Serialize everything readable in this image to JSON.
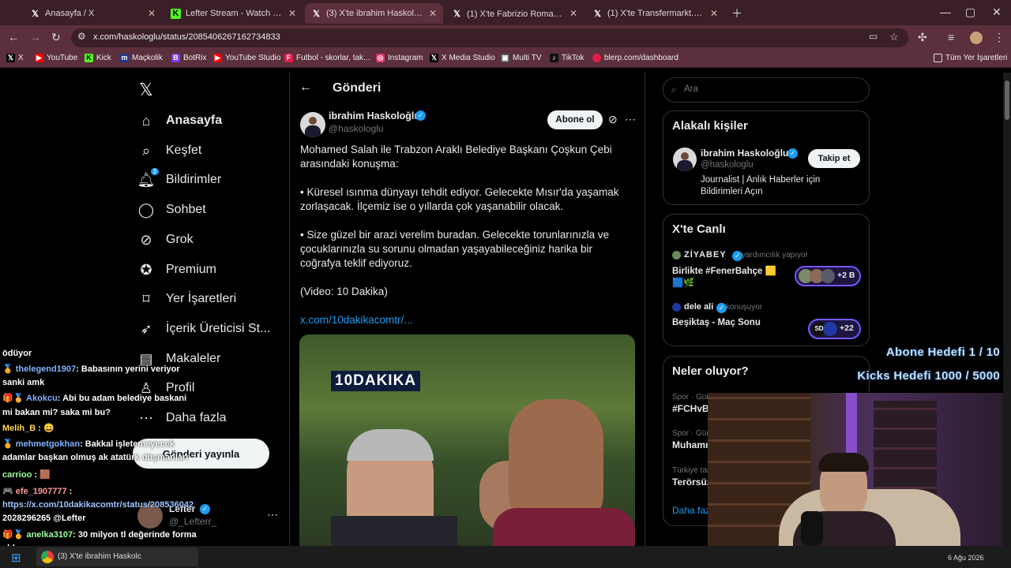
{
  "browser": {
    "tabs": [
      {
        "title": "Anasayfa / X",
        "icon": "x-icon",
        "color": "#ffffff"
      },
      {
        "title": "Lefter Stream - Watch Live on Kick",
        "icon": "kick-icon",
        "color": "#53fc18"
      },
      {
        "title": "(3) X'te ibrahim Haskoloğlu: \"M",
        "icon": "x-icon",
        "color": "#ffffff"
      },
      {
        "title": "(1) X'te Fabrizio Romano: \"🚨",
        "icon": "x-icon",
        "color": "#ffffff"
      },
      {
        "title": "(1) X'te Transfermarkt.com.tr: \"",
        "icon": "x-icon",
        "color": "#ffffff"
      }
    ],
    "url": "x.com/haskologlu/status/2085406267162734833",
    "bookmarks": [
      {
        "label": "X",
        "color": "#000000"
      },
      {
        "label": "YouTube",
        "color": "#ff0000"
      },
      {
        "label": "Kick",
        "color": "#53fc18"
      },
      {
        "label": "Maçkolik",
        "color": "#1e3a8a"
      },
      {
        "label": "BotRix",
        "color": "#7c3aed"
      },
      {
        "label": "YouTube Studio",
        "color": "#ff0000"
      },
      {
        "label": "Futbol - skorlar, tak...",
        "color": "#e11d48"
      },
      {
        "label": "Instagram",
        "color": "#e1306c"
      },
      {
        "label": "X Media Studio",
        "color": "#000000"
      },
      {
        "label": "Multi TV",
        "color": "#555555"
      },
      {
        "label": "TikTok",
        "color": "#111111"
      },
      {
        "label": "blerp.com/dashboard",
        "color": "#e11d48"
      }
    ],
    "all_bookmarks": "Tüm Yer İşaretleri"
  },
  "nav": {
    "items": [
      {
        "label": "Anasayfa",
        "icon": "home-icon"
      },
      {
        "label": "Keşfet",
        "icon": "search-icon"
      },
      {
        "label": "Bildirimler",
        "icon": "bell-icon",
        "badge": "3"
      },
      {
        "label": "Sohbet",
        "icon": "chat-icon"
      },
      {
        "label": "Grok",
        "icon": "grok-icon"
      },
      {
        "label": "Premium",
        "icon": "premium-icon"
      },
      {
        "label": "Yer İşaretleri",
        "icon": "bookmark-icon"
      },
      {
        "label": "İçerik Üreticisi St...",
        "icon": "rocket-icon"
      },
      {
        "label": "Makaleler",
        "icon": "article-icon"
      },
      {
        "label": "Profil",
        "icon": "profile-icon"
      },
      {
        "label": "Daha fazla",
        "icon": "more-icon"
      }
    ],
    "post_button": "Gönderi yayınla",
    "account": {
      "name": "Lefter",
      "handle": "@_Lefterr_"
    }
  },
  "post": {
    "header": "Gönderi",
    "author_name": "ibrahim Haskoloğlu",
    "author_handle": "@haskologlu",
    "subscribe": "Abone ol",
    "text1": "Mohamed Salah ile Trabzon Araklı Belediye Başkanı Çoşkun Çebi arasındaki konuşma:",
    "text2": "• Küresel ısınma dünyayı tehdit ediyor. Gelecekte Mısır'da yaşamak zorlaşacak. İlçemiz ise o yıllarda çok yaşanabilir olacak.",
    "text3": "• Size güzel bir arazi verelim buradan. Gelecekte torunlarınızla ve çocuklarınızla su sorunu olmadan yaşayabileceğiniz harika bir coğrafya teklif ediyoruz.",
    "text4": "(Video: 10 Dakika)",
    "link": "x.com/10dakikacomtr/...",
    "video_logo": "10DAKIKA"
  },
  "right": {
    "search_placeholder": "Ara",
    "related_title": "Alakalı kişiler",
    "related": {
      "name": "ibrahim Haskoloğlu",
      "handle": "@haskologlu",
      "follow": "Takip et",
      "bio": "Journalist | Anlık Haberler için Bildirimleri Açın"
    },
    "live_title": "X'te Canlı",
    "live": [
      {
        "host": "ZİYABEY",
        "status": "yardımcılık yapıyor",
        "title": "Birlikte #FenerBahçe 🟨🟦🌿",
        "count": "+2 B"
      },
      {
        "host": "dele ali",
        "status": "konuşuyor",
        "title": "Beşiktaş - Maç Sonu",
        "count": "+22"
      }
    ],
    "trends_title": "Neler oluyor?",
    "trends": [
      {
        "meta": "Spor · Gündemde",
        "name": "#FCHvB"
      },
      {
        "meta": "Spor · Gündemde",
        "name": "Muhammed"
      },
      {
        "meta": "Türkiye tarihinde",
        "name": "Terörsüz"
      }
    ],
    "more": "Daha fazla"
  },
  "stream": {
    "goal1": "Abone Hedefi 1 / 10",
    "goal2": "Kicks Hedefi 1000 / 5000",
    "chat": [
      {
        "user": "",
        "msg": "ödüyor"
      },
      {
        "user": "thelegend1907",
        "msg": ": Babasının yerini veriyor"
      },
      {
        "user": "",
        "msg": "sanki amk"
      },
      {
        "user": "Akokcu",
        "msg": ": Abi bu adam belediye baskani"
      },
      {
        "user": "",
        "msg": "mi bakan mi? saka mi bu?"
      },
      {
        "user": "Melih_B",
        "msg": ":"
      },
      {
        "user": "mehmetgokhan",
        "msg": ": Bakkal işletemeyecek"
      },
      {
        "user": "",
        "msg": "adamlar başkan olmuş ak atatürk düşmanları"
      },
      {
        "user": "carrioo",
        "msg": ":"
      },
      {
        "user": "efe_1907777",
        "msg": ":"
      },
      {
        "user": "",
        "msg": "https://x.com/10dakikacomtr/status/208536042"
      },
      {
        "user": "",
        "msg": "2028296265 @Lefter"
      },
      {
        "user": "anelka3107",
        "msg": ": 30 milyon tl değerinde forma"
      },
      {
        "user": "",
        "msg": "aldı"
      }
    ]
  },
  "taskbar": {
    "window": "(3) X'te ibrahim Haskolc",
    "date": "6 Ağu 2026"
  }
}
